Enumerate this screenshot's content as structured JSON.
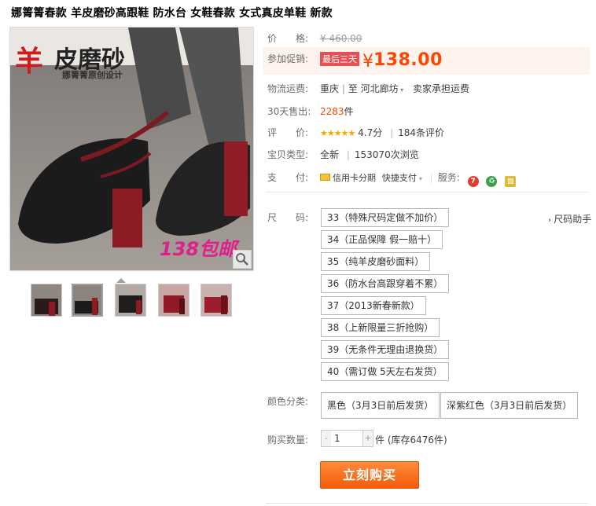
{
  "title": "娜箐箐春款 羊皮磨砂高跟鞋 防水台 女鞋春款 女式真皮单鞋 新款",
  "image_overlay": {
    "main_text": "皮磨砂",
    "sheep_char": "羊",
    "brand_text": "娜箐箐原创设计",
    "badge_text": "138包邮"
  },
  "price": {
    "label": "价　　格:",
    "original": "¥ 460.00"
  },
  "promo": {
    "label": "参加促销:",
    "tag": "最后三天",
    "currency": "¥",
    "value": "138.00"
  },
  "shipping": {
    "label": "物流运费:",
    "from": "重庆",
    "divider": "|",
    "to_prefix": "至",
    "to": "河北廊坊",
    "carrier": "卖家承担运费"
  },
  "sales": {
    "label": "30天售出:",
    "count": "2283",
    "unit": "件"
  },
  "rating": {
    "label": "评　　价:",
    "stars": "★★★★★",
    "score": "4.7分",
    "divider": "|",
    "reviews": "184条评价"
  },
  "product_type": {
    "label": "宝贝类型:",
    "value": "全新",
    "divider": "|",
    "views": "153070次浏览"
  },
  "payment": {
    "label": "支　　付:",
    "method1": "信用卡分期",
    "method2": "快捷支付",
    "service_label": "服务:"
  },
  "size": {
    "label": "尺　　码:",
    "help": "尺码助手",
    "options": [
      "33（特殊尺码定做不加价）",
      "34（正品保障 假一赔十）",
      "35（纯羊皮磨砂面料）",
      "36（防水台高跟穿着不累）",
      "37（2013新春新款）",
      "38（上新限量三折抢购）",
      "39（无条件无理由退换货）",
      "40（需订做 5天左右发货）"
    ]
  },
  "color": {
    "label": "颜色分类:",
    "options": [
      "黑色（3月3日前后发货）",
      "深紫红色（3月3日前后发货）"
    ]
  },
  "quantity": {
    "label": "购买数量:",
    "value": "1",
    "minus": "-",
    "plus": "+",
    "note": "件 (库存6476件)"
  },
  "buy_button": "立刻购买",
  "colors": {
    "accent": "#ff4400",
    "button": "#f25d0c",
    "promo_bg": "#fff3ee",
    "tag": "#e45055"
  },
  "icons": {
    "service": [
      "seven-day-return-icon",
      "recycle-guarantee-icon",
      "credit-card-icon"
    ]
  }
}
